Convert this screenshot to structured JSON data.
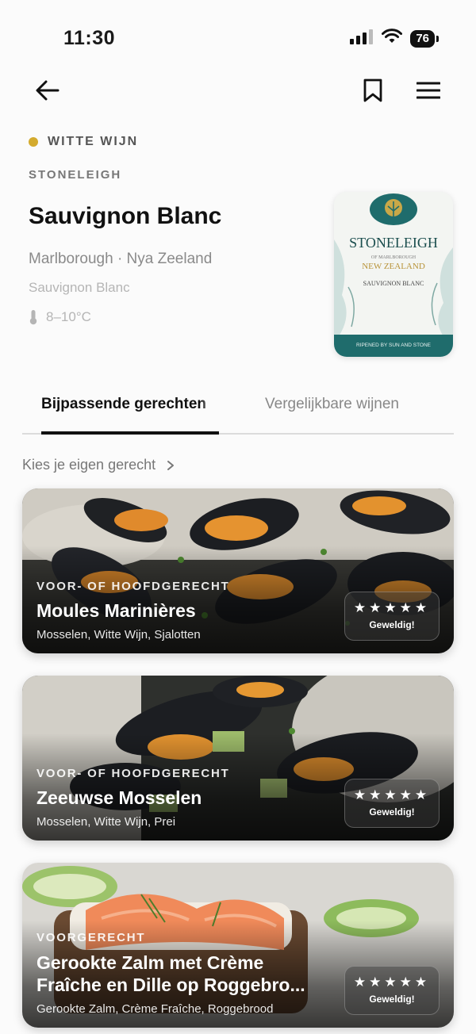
{
  "status_bar": {
    "time": "11:30",
    "battery": "76"
  },
  "wine": {
    "type_label": "WITTE WIJN",
    "type_color": "#d4ab2e",
    "producer": "STONELEIGH",
    "name": "Sauvignon Blanc",
    "region": "Marlborough · Nya Zeeland",
    "grape": "Sauvignon Blanc",
    "temperature": "8–10°C",
    "label": {
      "brand": "STONELEIGH",
      "of": "OF MARLBOROUGH",
      "country": "NEW ZEALAND",
      "variety": "SAUVIGNON BLANC",
      "tagline": "RIPENED BY SUN AND STONE"
    }
  },
  "tabs": [
    {
      "label": "Bijpassende gerechten",
      "active": true
    },
    {
      "label": "Vergelijkbare wijnen",
      "active": false
    }
  ],
  "choose_dish": "Kies je eigen gerecht",
  "dishes": [
    {
      "course": "VOOR- OF HOOFDGERECHT",
      "title": "Moules Marinières",
      "ingredients": "Mosselen, Witte Wijn, Sjalotten",
      "stars": "★★★★★",
      "rating_label": "Geweldig!"
    },
    {
      "course": "VOOR- OF HOOFDGERECHT",
      "title": "Zeeuwse Mosselen",
      "ingredients": "Mosselen, Witte Wijn, Prei",
      "stars": "★★★★★",
      "rating_label": "Geweldig!"
    },
    {
      "course": "VOORGERECHT",
      "title_line1": "Gerookte Zalm met Crème",
      "title_line2": "Fraîche en Dille op Roggebro...",
      "ingredients": "Gerookte Zalm, Crème Fraîche, Roggebrood",
      "stars": "★★★★★",
      "rating_label": "Geweldig!"
    }
  ]
}
